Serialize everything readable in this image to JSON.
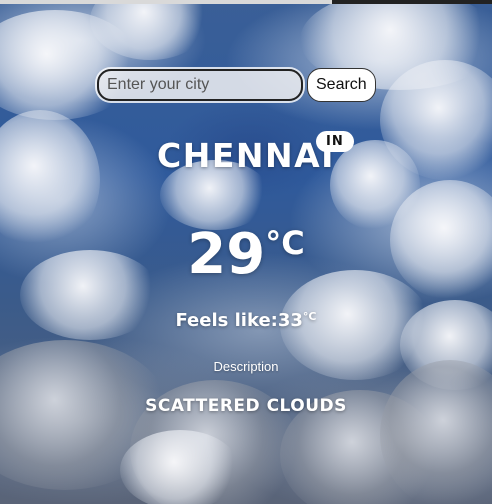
{
  "search": {
    "placeholder": "Enter your city",
    "value": "",
    "button_label": "Search"
  },
  "location": {
    "city": "CHENNAI",
    "country_code": "IN"
  },
  "weather": {
    "temperature": "29",
    "temperature_unit": "°C",
    "feels_like_label": "Feels like:",
    "feels_like_value": "33",
    "feels_like_unit": "°C",
    "description_label": "Description",
    "description": "SCATTERED CLOUDS"
  },
  "theme": {
    "text_color": "#ffffff",
    "badge_bg": "#ffffff",
    "sky_blue": "#2f5a9c"
  }
}
